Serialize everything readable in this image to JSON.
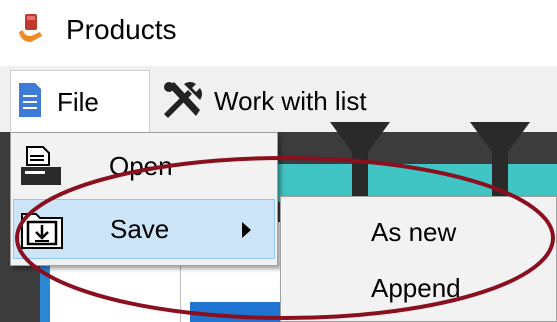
{
  "window": {
    "title": "Products"
  },
  "menubar": {
    "file_label": "File",
    "work_label": "Work with list"
  },
  "file_menu": {
    "items": [
      {
        "label": "Open",
        "icon": "open-printer-icon"
      },
      {
        "label": "Save",
        "icon": "save-download-icon",
        "has_submenu": true
      }
    ]
  },
  "save_submenu": {
    "items": [
      {
        "label": "As new"
      },
      {
        "label": "Append"
      }
    ]
  },
  "colors": {
    "highlight": "#cce4f7",
    "annotation": "#8a1020",
    "teal": "#41c4c4",
    "accent_blue": "#1e74d0"
  }
}
